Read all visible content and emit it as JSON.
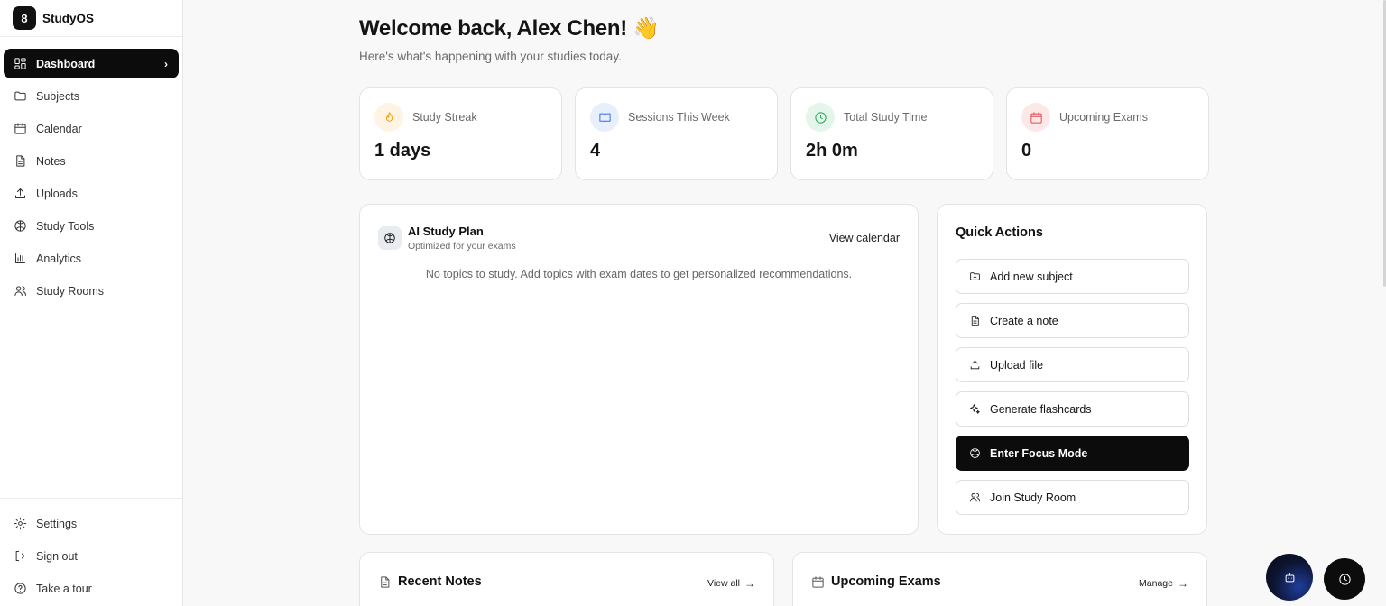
{
  "app": {
    "logo_text": "8",
    "name": "StudyOS"
  },
  "sidebar": {
    "items": [
      {
        "label": "Dashboard",
        "icon": "dashboard-grid-icon",
        "active": true
      },
      {
        "label": "Subjects",
        "icon": "folder-icon"
      },
      {
        "label": "Calendar",
        "icon": "calendar-icon"
      },
      {
        "label": "Notes",
        "icon": "document-icon"
      },
      {
        "label": "Uploads",
        "icon": "upload-icon"
      },
      {
        "label": "Study Tools",
        "icon": "brain-icon"
      },
      {
        "label": "Analytics",
        "icon": "bar-chart-icon"
      },
      {
        "label": "Study Rooms",
        "icon": "users-icon"
      }
    ],
    "bottom": [
      {
        "label": "Settings",
        "icon": "gear-icon"
      },
      {
        "label": "Sign out",
        "icon": "sign-out-icon"
      },
      {
        "label": "Take a tour",
        "icon": "help-circle-icon"
      }
    ]
  },
  "header": {
    "welcome": "Welcome back, Alex Chen! 👋",
    "subtitle": "Here's what's happening with your studies today."
  },
  "stats": [
    {
      "label": "Study Streak",
      "value": "1 days",
      "icon": "flame-icon",
      "color": "#f59e0b",
      "bg": "#fff4e3"
    },
    {
      "label": "Sessions This Week",
      "value": "4",
      "icon": "book-open-icon",
      "color": "#3b6fe0",
      "bg": "#e7eefc"
    },
    {
      "label": "Total Study Time",
      "value": "2h 0m",
      "icon": "clock-icon",
      "color": "#22a35a",
      "bg": "#e4f6ea"
    },
    {
      "label": "Upcoming Exams",
      "value": "0",
      "icon": "calendar-icon",
      "color": "#e5484d",
      "bg": "#fde8e8"
    }
  ],
  "study_plan": {
    "title": "AI Study Plan",
    "subtitle": "Optimized for your exams",
    "link": "View calendar",
    "empty": "No topics to study. Add topics with exam dates to get personalized recommendations."
  },
  "quick_actions": {
    "title": "Quick Actions",
    "items": [
      {
        "label": "Add new subject",
        "icon": "folder-plus-icon"
      },
      {
        "label": "Create a note",
        "icon": "document-icon"
      },
      {
        "label": "Upload file",
        "icon": "upload-icon"
      },
      {
        "label": "Generate flashcards",
        "icon": "sparkles-icon"
      },
      {
        "label": "Enter Focus Mode",
        "icon": "brain-icon",
        "primary": true
      },
      {
        "label": "Join Study Room",
        "icon": "users-icon"
      }
    ]
  },
  "recent_notes": {
    "title": "Recent Notes",
    "link": "View all"
  },
  "upcoming_exams": {
    "title": "Upcoming Exams",
    "link": "Manage"
  }
}
